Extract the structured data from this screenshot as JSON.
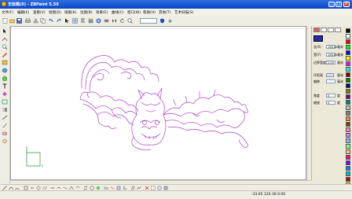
{
  "window": {
    "title": "无标题(0) - ZBPaint 5.50",
    "minimize": "_",
    "maximize": "□",
    "close": "×"
  },
  "menu": [
    "文件(F)",
    "编辑(E)",
    "查看(V)",
    "绘图(D)",
    "排版(K)",
    "位图(B)",
    "效果(E)",
    "曲线(C)",
    "窗口(W)",
    "帮助(H)",
    "其他(T)",
    "艺术扫描(S)"
  ],
  "toolbar": {
    "zoom_value": ""
  },
  "panel": {
    "fields": [
      {
        "label": "长(X)",
        "value": "158.00",
        "unit": "毫米"
      },
      {
        "label": "宽(Y)",
        "value": "158.00",
        "unit": "毫米"
      },
      {
        "label": "边界宽度",
        "value": "2.00",
        "unit": "毫米"
      },
      {
        "label": "环距离",
        "value": "",
        "unit": "毫米"
      },
      {
        "label": "偏移",
        "value": "",
        "unit": "毫米"
      },
      {
        "label": "角度",
        "value": "0",
        "unit": "度"
      },
      {
        "label": "缩放",
        "value": "0",
        "unit": "度"
      }
    ]
  },
  "palette_colors": [
    "#000000",
    "#ffffff",
    "#ff0000",
    "#00ff00",
    "#0000ff",
    "#ffff00",
    "#ff00ff",
    "#00ffff",
    "#800000",
    "#008000",
    "#000080",
    "#808000",
    "#800080",
    "#008080",
    "#c0c0c0",
    "#808080",
    "#ff8040",
    "#804000",
    "#ff80c0",
    "#c080ff",
    "#80c0ff",
    "#80ff80",
    "#ffc080",
    "#ff0080",
    "#8000ff",
    "#0080ff",
    "#00c0c0",
    "#c00000",
    "#ffd700"
  ],
  "accent": {
    "artwork": "#b040c8",
    "axis": "#209020"
  },
  "axis": {
    "y_label": "Y"
  },
  "status": {
    "coords": "-33.65 120.36 0.00"
  }
}
